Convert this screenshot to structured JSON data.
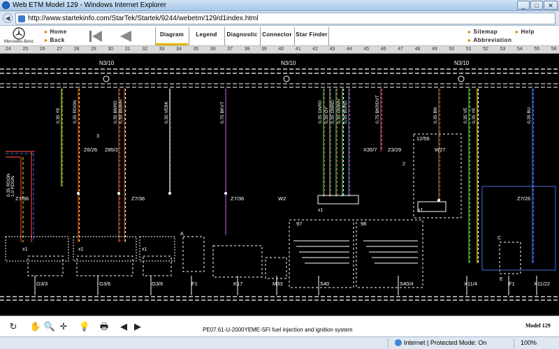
{
  "window": {
    "title": "Web ETM Model 129 - Windows Internet Explorer",
    "url": "http://www.startekinfo.com/StarTek/Startek/9244/webetm/129/d1index.html"
  },
  "toolbar": {
    "brand": "Mercedes-Benz",
    "home": "Home",
    "back": "Back",
    "sitemap": "Sitemap",
    "help": "Help",
    "abbreviation": "Abbreviation",
    "tabs": [
      "Diagram",
      "Legend",
      "Diagnostic",
      "Connector",
      "Star Finder"
    ],
    "active_tab": "Diagram"
  },
  "ruler": [
    "24",
    "25",
    "26",
    "27",
    "28",
    "29",
    "30",
    "31",
    "32",
    "33",
    "34",
    "35",
    "36",
    "37",
    "38",
    "39",
    "40",
    "41",
    "42",
    "43",
    "44",
    "45",
    "46",
    "47",
    "48",
    "49",
    "50",
    "51",
    "52",
    "53",
    "54",
    "55",
    "56"
  ],
  "diagram": {
    "buses": [
      "N3/10",
      "N3/10",
      "N3/10"
    ],
    "components": [
      "Z6/26",
      "Z85/2",
      "Z7/36",
      "Z7/36",
      "Z7/36",
      "W2",
      "X35/7",
      "Z3/29",
      "12/56",
      "W27",
      "Z7/26",
      "97",
      "98",
      "G3/3",
      "G3/6",
      "G3/6",
      "F1",
      "K17",
      "M33",
      "S40",
      "S40/4",
      "X11/4",
      "F1",
      "X11/22"
    ],
    "wires": [
      "0,35 YE",
      "0,35 RDGN",
      "0,35 BNRD",
      "0,35 BNWH",
      "0,35 VEBK",
      "0,75 BKVT",
      "0,35 GNRD",
      "0,35 GY",
      "0,35 GNRD",
      "0,35 GNWH",
      "0,35 BURD",
      "0,75 BKRDVT",
      "0,35 BN",
      "0,75 GYRD",
      "0,75 BKRDVT",
      "4,0 RDWH",
      "4,0 RDGN",
      "4,0 GYBN",
      "4,0 BN",
      "0,35 VE",
      "0,35 YE",
      "2,5 RDWH",
      "0,35 BU"
    ],
    "labels": [
      "x1",
      "x1",
      "x1",
      "x1",
      "x1",
      "A",
      "C",
      "E",
      "3",
      "2"
    ]
  },
  "footer": {
    "doc_id": "PE07.61-U-2000YE",
    "doc_title": "ME-SFI fuel injection and ignition system",
    "model": "Model 129"
  },
  "status": {
    "zone": "Internet | Protected Mode: On",
    "zoom": "100%"
  },
  "colors": {
    "title_bg": "#a9c8e8",
    "diagram_bg": "#000000",
    "tab_underline": "#e4b400",
    "wire_white": "#ffffff"
  }
}
